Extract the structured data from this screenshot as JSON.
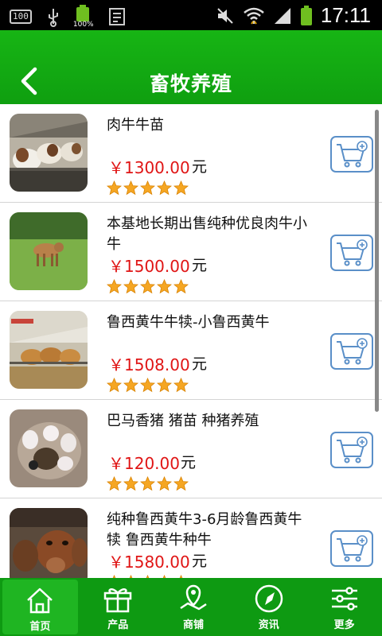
{
  "status_bar": {
    "notification_badge": "100",
    "battery_percent": "100%",
    "time": "17:11"
  },
  "header": {
    "title": "畜牧养殖",
    "back_icon": "chevron-left-icon"
  },
  "products": [
    {
      "title": "肉牛牛苗",
      "price": "￥1300.00",
      "unit": "元",
      "rating": 5
    },
    {
      "title": "本基地长期出售纯种优良肉牛小牛",
      "price": "￥1500.00",
      "unit": "元",
      "rating": 5
    },
    {
      "title": "鲁西黄牛牛犊-小鲁西黄牛",
      "price": "￥1508.00",
      "unit": "元",
      "rating": 5
    },
    {
      "title": "巴马香猪 猪苗 种猪养殖",
      "price": "￥120.00",
      "unit": "元",
      "rating": 5
    },
    {
      "title": "纯种鲁西黄牛3-6月龄鲁西黄牛犊 鲁西黄牛种牛",
      "price": "￥1580.00",
      "unit": "元",
      "rating": 5
    }
  ],
  "tabs": [
    {
      "label": "首页",
      "icon": "home-icon",
      "active": true
    },
    {
      "label": "产品",
      "icon": "gift-icon",
      "active": false
    },
    {
      "label": "商铺",
      "icon": "map-icon",
      "active": false
    },
    {
      "label": "资讯",
      "icon": "compass-icon",
      "active": false
    },
    {
      "label": "更多",
      "icon": "sliders-icon",
      "active": false
    }
  ],
  "colors": {
    "header_green": "#0f9f10",
    "price_red": "#e01515",
    "star_orange": "#f5a623",
    "cart_blue": "#5a8fc8"
  }
}
